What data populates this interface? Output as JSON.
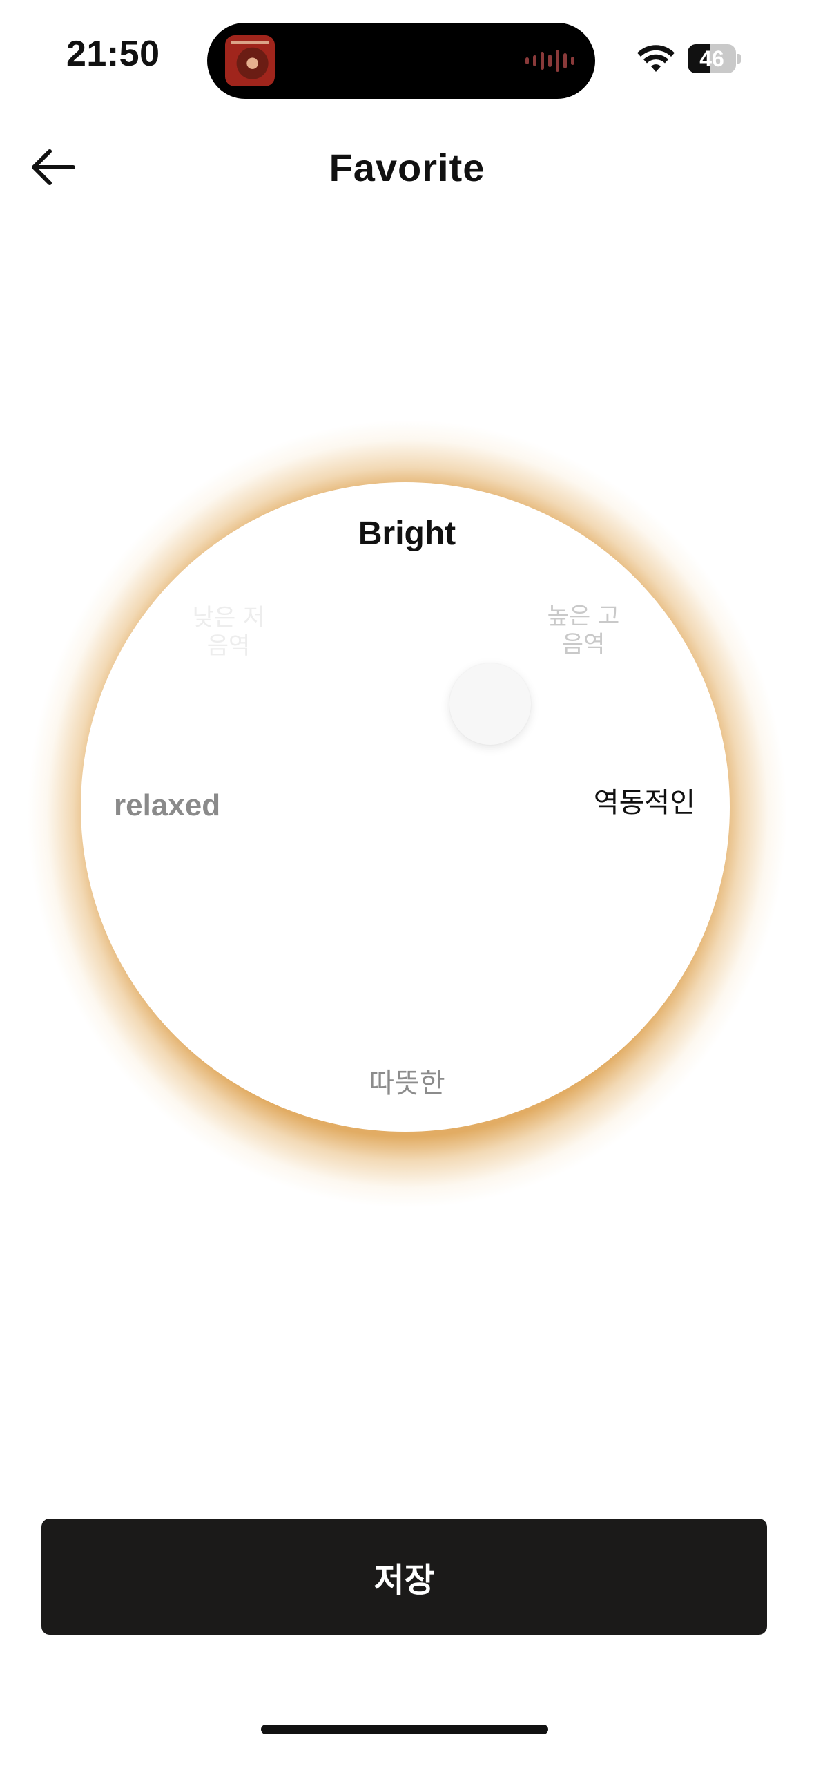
{
  "status_bar": {
    "time": "21:50",
    "battery_level": "46",
    "wifi_icon": "wifi-icon",
    "now_playing_icon": "album-art-icon",
    "audio_wave_icon": "audio-waveform-icon"
  },
  "header": {
    "back_icon": "arrow-left-icon",
    "title": "Favorite"
  },
  "dial": {
    "top_label": "Bright",
    "left_label": "relaxed",
    "right_label": "역동적인",
    "bottom_label": "따뜻한",
    "upper_left_label": "낮은 저음역",
    "upper_right_label": "높은 고음역",
    "glow_color": "#E0A85C"
  },
  "actions": {
    "save_label": "저장"
  }
}
